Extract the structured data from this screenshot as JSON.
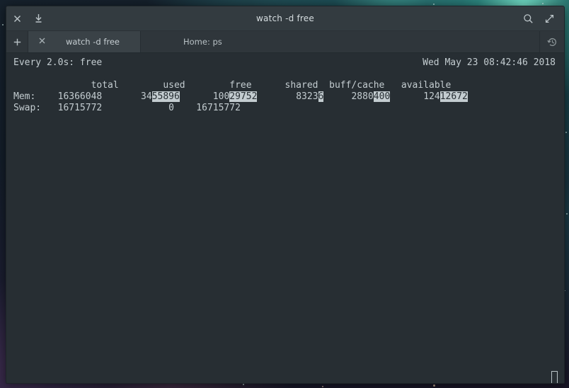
{
  "window": {
    "title": "watch -d free",
    "titlebar_buttons": [
      {
        "name": "close-icon",
        "glyph": "×"
      },
      {
        "name": "minimize-to-tray-icon",
        "glyph": "⤓"
      }
    ],
    "titlebar_right_buttons": [
      {
        "name": "search-icon",
        "glyph": "⚲"
      },
      {
        "name": "maximize-icon",
        "glyph": "⤡"
      }
    ]
  },
  "tabbar": {
    "new_tab_label": "+",
    "close_tab_label": "×",
    "tabs": [
      {
        "label": "watch -d free",
        "active": true,
        "closable": true
      },
      {
        "label": "Home: ps",
        "active": false,
        "closable": false
      }
    ],
    "history_icon": "history-icon"
  },
  "terminal": {
    "status_left": "Every 2.0s: free",
    "status_right": "Wed May 23 08:42:46 2018",
    "columns": {
      "row_label": "",
      "total": "total",
      "used": "used",
      "free": "free",
      "shared": "shared",
      "buff_cache": "buff/cache",
      "available": "available"
    },
    "header_line": "              total        used        free      shared  buff/cache   available",
    "rows": [
      {
        "label": "Mem:",
        "cells": [
          {
            "plain": "    16366048",
            "highlight": ""
          },
          {
            "plain": "       34",
            "highlight": "55896"
          },
          {
            "plain": "      100",
            "highlight": "29752"
          },
          {
            "plain": "       8323",
            "highlight": "6"
          },
          {
            "plain": "     2880",
            "highlight": "400"
          },
          {
            "plain": "      124",
            "highlight": "12672"
          }
        ]
      },
      {
        "label": "Swap:",
        "cells": [
          {
            "plain": "   16715772",
            "highlight": ""
          },
          {
            "plain": "            0",
            "highlight": ""
          },
          {
            "plain": "    16715772",
            "highlight": ""
          }
        ]
      }
    ],
    "cursor": {
      "name": "terminal-cursor",
      "visible": true
    }
  },
  "colors": {
    "terminal_bg": "#272e33",
    "terminal_fg": "#c3ccd0",
    "titlebar_bg": "#333b40",
    "tabbar_bg": "#2f363b",
    "tab_active_bg": "#3a4247",
    "highlight_bg": "#c3ccd0",
    "highlight_fg": "#272e33"
  }
}
